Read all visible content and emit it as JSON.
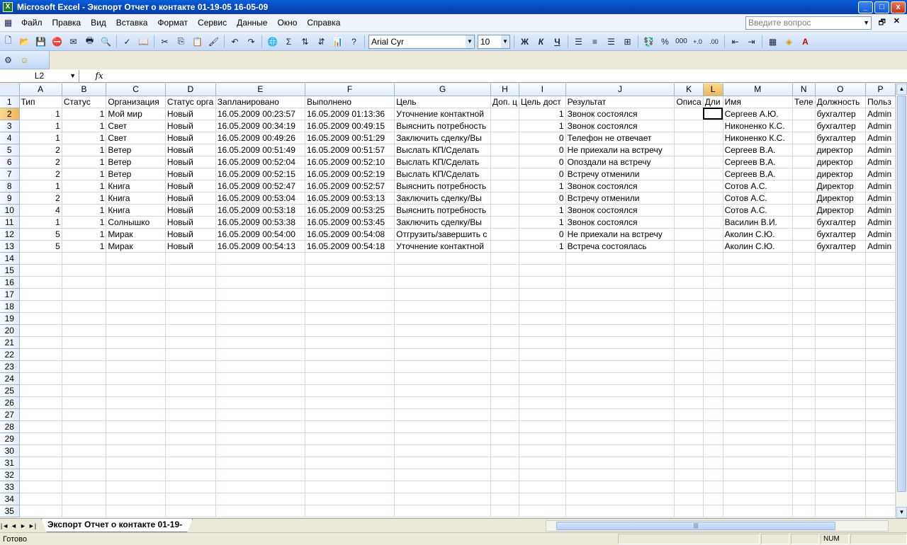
{
  "window": {
    "title": "Microsoft Excel - Экспорт Отчет о контакте 01-19-05 16-05-09",
    "min": "_",
    "max": "□",
    "close": "x"
  },
  "menu": [
    "Файл",
    "Правка",
    "Вид",
    "Вставка",
    "Формат",
    "Сервис",
    "Данные",
    "Окно",
    "Справка"
  ],
  "help_placeholder": "Введите вопрос",
  "toolbar": {
    "font": "Arial Cyr",
    "size": "10",
    "bold": "Ж",
    "italic": "К",
    "underline": "Ч",
    "percent": "%",
    "thousands": "000",
    "sum": "Σ"
  },
  "formula": {
    "namebox": "L2",
    "fx": "fx",
    "value": ""
  },
  "columns": [
    "A",
    "B",
    "C",
    "D",
    "E",
    "F",
    "G",
    "H",
    "I",
    "J",
    "K",
    "L",
    "M",
    "N",
    "O",
    "P"
  ],
  "selected_column": "L",
  "selected_row": 2,
  "header_row": [
    "Тип",
    "Статус",
    "Организация",
    "Статус орга",
    "Запланировано",
    "Выполнено",
    "Цель",
    "Доп. ц",
    "Цель дост",
    "Результат",
    "Описа",
    "Дли",
    "Имя",
    "Теле",
    "Должность",
    "Польз"
  ],
  "rows": [
    [
      "1",
      "1",
      "Мой мир",
      "Новый",
      "16.05.2009 00:23:57",
      "16.05.2009 01:13:36",
      "Уточнение контактной",
      "",
      "1",
      "Звонок состоялся",
      "",
      "",
      "Сергеев А.Ю.",
      "",
      "бухгалтер",
      "Admin"
    ],
    [
      "1",
      "1",
      "Свет",
      "Новый",
      "16.05.2009 00:34:19",
      "16.05.2009 00:49:15",
      "Выяснить потребность",
      "",
      "1",
      "Звонок состоялся",
      "",
      "",
      "Никоненко К.С.",
      "",
      "бухгалтер",
      "Admin"
    ],
    [
      "1",
      "1",
      "Свет",
      "Новый",
      "16.05.2009 00:49:26",
      "16.05.2009 00:51:29",
      "Заключить сделку/Вы",
      "",
      "0",
      "Телефон не отвечает",
      "",
      "",
      "Никоненко К.С.",
      "",
      "бухгалтер",
      "Admin"
    ],
    [
      "2",
      "1",
      "Ветер",
      "Новый",
      "16.05.2009 00:51:49",
      "16.05.2009 00:51:57",
      "Выслать КП/Сделать",
      "",
      "0",
      "Не приехали на встречу",
      "",
      "",
      "Сергеев В.А.",
      "",
      "директор",
      "Admin"
    ],
    [
      "2",
      "1",
      "Ветер",
      "Новый",
      "16.05.2009 00:52:04",
      "16.05.2009 00:52:10",
      "Выслать КП/Сделать",
      "",
      "0",
      "Опоздали на встречу",
      "",
      "",
      "Сергеев В.А.",
      "",
      "директор",
      "Admin"
    ],
    [
      "2",
      "1",
      "Ветер",
      "Новый",
      "16.05.2009 00:52:15",
      "16.05.2009 00:52:19",
      "Выслать КП/Сделать",
      "",
      "0",
      "Встречу отменили",
      "",
      "",
      "Сергеев В.А.",
      "",
      "директор",
      "Admin"
    ],
    [
      "1",
      "1",
      "Книга",
      "Новый",
      "16.05.2009 00:52:47",
      "16.05.2009 00:52:57",
      "Выяснить потребность",
      "",
      "1",
      "Звонок состоялся",
      "",
      "",
      "Сотов А.С.",
      "",
      "Директор",
      "Admin"
    ],
    [
      "2",
      "1",
      "Книга",
      "Новый",
      "16.05.2009 00:53:04",
      "16.05.2009 00:53:13",
      "Заключить сделку/Вы",
      "",
      "0",
      "Встречу отменили",
      "",
      "",
      "Сотов А.С.",
      "",
      "Директор",
      "Admin"
    ],
    [
      "4",
      "1",
      "Книга",
      "Новый",
      "16.05.2009 00:53:18",
      "16.05.2009 00:53:25",
      "Выяснить потребность",
      "",
      "1",
      "Звонок состоялся",
      "",
      "",
      "Сотов А.С.",
      "",
      "Директор",
      "Admin"
    ],
    [
      "1",
      "1",
      "Солнышко",
      "Новый",
      "16.05.2009 00:53:38",
      "16.05.2009 00:53:45",
      "Заключить сделку/Вы",
      "",
      "1",
      "Звонок состоялся",
      "",
      "",
      "Василин В.И.",
      "",
      "бухгалтер",
      "Admin"
    ],
    [
      "5",
      "1",
      "Мирак",
      "Новый",
      "16.05.2009 00:54:00",
      "16.05.2009 00:54:08",
      "Отгрузить/завершить с",
      "",
      "0",
      "Не приехали на встречу",
      "",
      "",
      "Аколин С.Ю.",
      "",
      "бухгалтер",
      "Admin"
    ],
    [
      "5",
      "1",
      "Мирак",
      "Новый",
      "16.05.2009 00:54:13",
      "16.05.2009 00:54:18",
      "Уточнение контактной",
      "",
      "1",
      "Встреча состоялась",
      "",
      "",
      "Аколин С.Ю.",
      "",
      "бухгалтер",
      "Admin"
    ]
  ],
  "total_rows": 35,
  "sheet_tab": "Экспорт Отчет о контакте 01-19-",
  "status": {
    "left": "Готово",
    "num": "NUM"
  }
}
